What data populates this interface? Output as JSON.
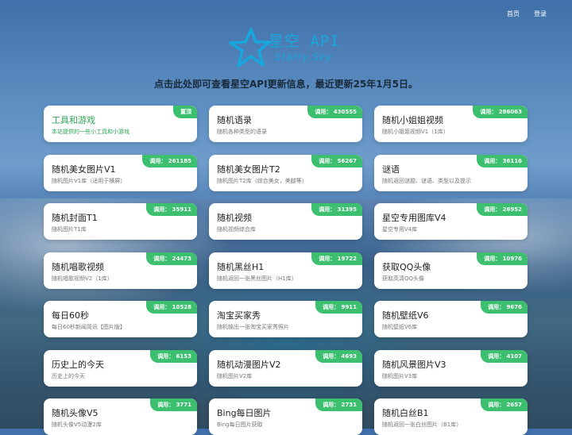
{
  "nav": {
    "home": "首页",
    "login": "登录"
  },
  "logo": {
    "cn": "星空 API",
    "en": "Starry Sky"
  },
  "headline": "点击此处即可查看星空API更新信息，最近更新25年1月5日。",
  "cards": [
    {
      "title": "工具和游戏",
      "desc": "本站提供的一些小工具和小游戏",
      "badge": "置顶",
      "green": true
    },
    {
      "title": "随机语录",
      "desc": "随机各种类型的语录",
      "badge": "调用： 430555"
    },
    {
      "title": "随机小姐姐视频",
      "desc": "随机小姐姐视频V1（1库）",
      "badge": "调用： 286063"
    },
    {
      "title": "随机美女图片V1",
      "desc": "随机图片V1库（适用于横屏）",
      "badge": "调用： 261185"
    },
    {
      "title": "随机美女图片T2",
      "desc": "随机图片T2库（综合美女，美腿等）",
      "badge": "调用： 56267"
    },
    {
      "title": "谜语",
      "desc": "随机返回谜题、谜语、类型以及提示",
      "badge": "调用： 36116"
    },
    {
      "title": "随机封面T1",
      "desc": "随机图片T1库",
      "badge": "调用： 35911"
    },
    {
      "title": "随机视频",
      "desc": "随机视频综合库",
      "badge": "调用： 31395"
    },
    {
      "title": "星空专用图库V4",
      "desc": "星空专用V4库",
      "badge": "调用： 26952"
    },
    {
      "title": "随机唱歌视频",
      "desc": "随机唱歌视频V2（1库）",
      "badge": "调用： 24473"
    },
    {
      "title": "随机黑丝H1",
      "desc": "随机返回一张黑丝图片（H1库）",
      "badge": "调用： 19722"
    },
    {
      "title": "获取QQ头像",
      "desc": "获取高清QQ头像",
      "badge": "调用： 10976"
    },
    {
      "title": "每日60秒",
      "desc": "每日60秒新闻简讯【图片版】",
      "badge": "调用： 10528"
    },
    {
      "title": "淘宝买家秀",
      "desc": "随机输出一张淘宝买家秀照片",
      "badge": "调用： 9911"
    },
    {
      "title": "随机壁纸V6",
      "desc": "随机壁纸V6库",
      "badge": "调用： 9676"
    },
    {
      "title": "历史上的今天",
      "desc": "历史上的今天",
      "badge": "调用： 6153"
    },
    {
      "title": "随机动漫图片V2",
      "desc": "随机图片V2库",
      "badge": "调用： 4693"
    },
    {
      "title": "随机风景图片V3",
      "desc": "随机图片V3库",
      "badge": "调用： 4107"
    },
    {
      "title": "随机头像V5",
      "desc": "随机头像V5动漫2库",
      "badge": "调用： 3771"
    },
    {
      "title": "Bing每日图片",
      "desc": "Bing每日图片获取",
      "badge": "调用： 2731"
    },
    {
      "title": "随机白丝B1",
      "desc": "随机返回一张白丝图片（B1库）",
      "badge": "调用： 2657"
    }
  ]
}
